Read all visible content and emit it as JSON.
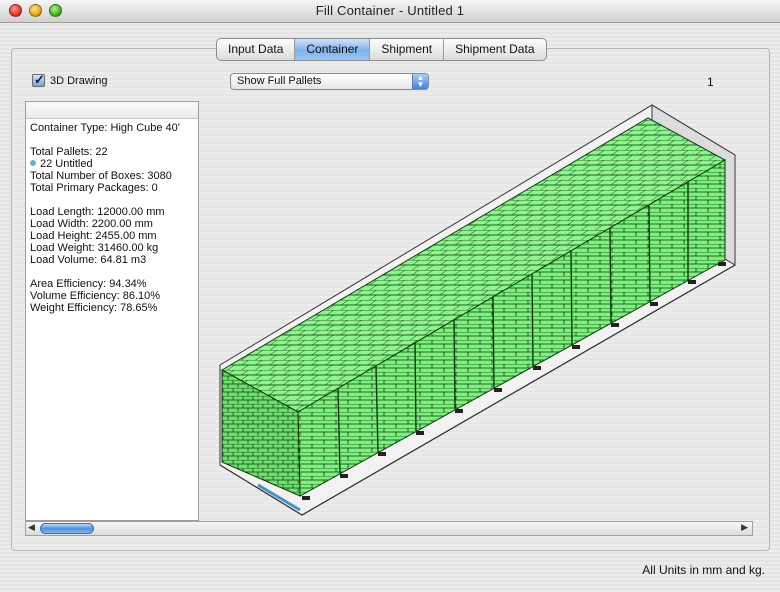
{
  "window": {
    "title": "Fill Container - Untitled 1"
  },
  "tabs": [
    {
      "label": "Input Data",
      "active": false
    },
    {
      "label": "Container",
      "active": true
    },
    {
      "label": "Shipment",
      "active": false
    },
    {
      "label": "Shipment Data",
      "active": false
    }
  ],
  "controls": {
    "drawing_3d_label": "3D Drawing",
    "drawing_3d_checked": true,
    "pallet_view_value": "Show Full Pallets",
    "page_number": "1"
  },
  "info": {
    "container_type": "Container Type: High Cube 40'",
    "total_pallets": "Total Pallets: 22",
    "pallet_entry": "22 Untitled",
    "total_boxes": "Total Number of Boxes: 3080",
    "total_primary": "Total Primary Packages: 0",
    "load_length": "Load Length: 12000.00 mm",
    "load_width": "Load Width: 2200.00 mm",
    "load_height": "Load Height: 2455.00 mm",
    "load_weight": "Load Weight: 31460.00 kg",
    "load_volume": "Load Volume: 64.81 m3",
    "area_efficiency": "Area Efficiency: 94.34%",
    "volume_efficiency": "Volume Efficiency: 86.10%",
    "weight_efficiency": "Weight Efficiency: 78.65%",
    "pallet_dot_color": "#69b1d2"
  },
  "footer": {
    "units_note": "All Units in mm and kg."
  },
  "scroll": {
    "position_fraction": 0.0
  },
  "drawing": {
    "icon": "container-3d-drawing",
    "box_color": "#7cf07c",
    "box_line_color": "#0c3a0c",
    "pallet_count": 22
  }
}
